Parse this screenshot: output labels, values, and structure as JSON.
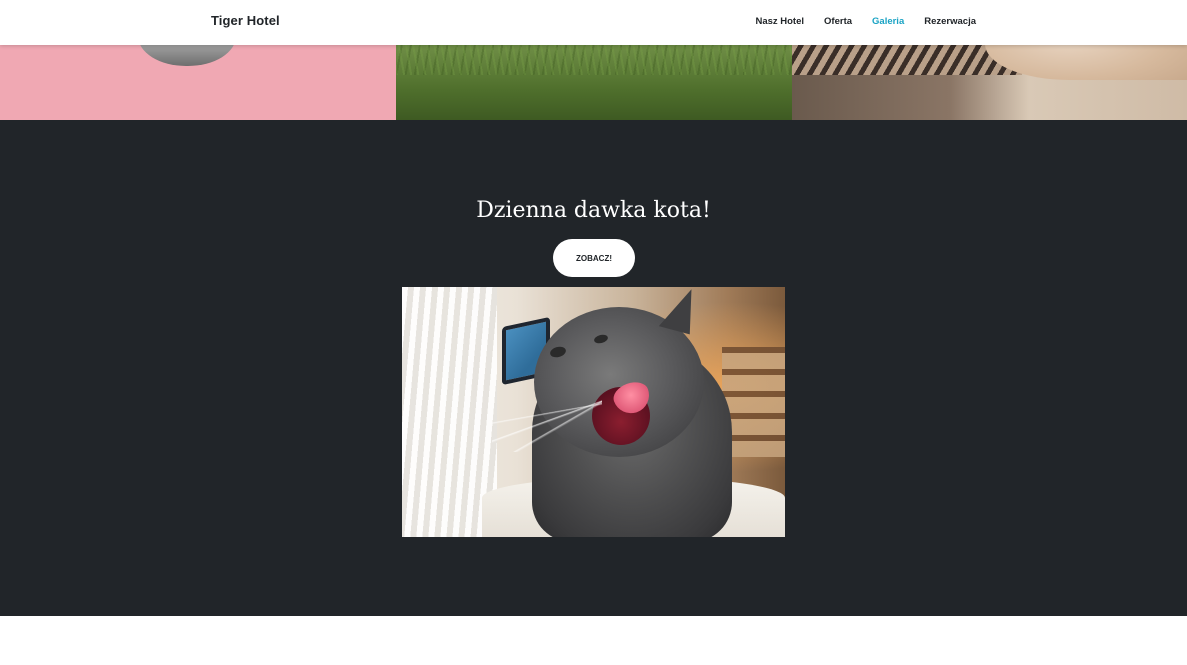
{
  "navbar": {
    "brand": "Tiger Hotel",
    "links": [
      {
        "label": "Nasz Hotel",
        "active": false
      },
      {
        "label": "Oferta",
        "active": false
      },
      {
        "label": "Galeria",
        "active": true
      },
      {
        "label": "Rezerwacja",
        "active": false
      }
    ],
    "active_color": "#1aa3c4"
  },
  "gallery": {
    "tiles": [
      {
        "subject": "cat-eating-from-bowl-photo"
      },
      {
        "subject": "cat-in-grass-photo"
      },
      {
        "subject": "cat-on-wooden-deck-photo"
      }
    ]
  },
  "hero": {
    "title": "Dzienna dawka kota!",
    "button_label": "ZOBACZ!",
    "background": "#212529",
    "featured_image": "grey-cat-licking-lips-photo"
  }
}
